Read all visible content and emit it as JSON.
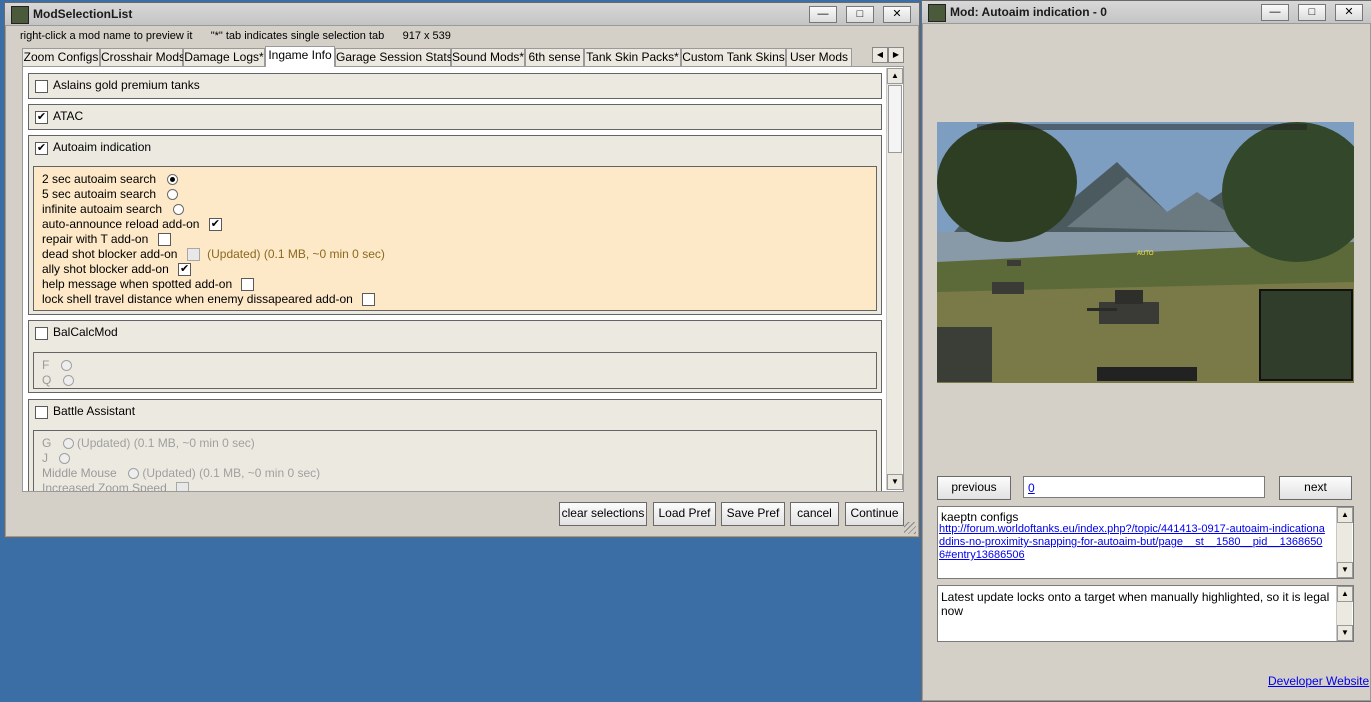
{
  "main_window": {
    "title": "ModSelectionList",
    "hint": "right-click a mod name to preview it      \"*\" tab indicates single selection tab      917 x 539",
    "tabs": [
      "Zoom Configs",
      "Crosshair Mods",
      "Damage Logs*",
      "Ingame Info",
      "Garage Session Stats*",
      "Sound Mods*",
      "6th sense",
      "Tank Skin Packs*",
      "Custom Tank Skins",
      "User Mods"
    ],
    "active_tab": "Ingame Info",
    "groups": {
      "aslains": {
        "label": "Aslains gold premium tanks",
        "checked": false
      },
      "atac": {
        "label": "ATAC",
        "checked": true
      },
      "autoaim": {
        "label": "Autoaim indication",
        "checked": true,
        "options": [
          {
            "label": "2 sec autoaim search",
            "kind": "radio",
            "on": true
          },
          {
            "label": "5 sec autoaim search",
            "kind": "radio",
            "on": false
          },
          {
            "label": "infinite autoaim search",
            "kind": "radio",
            "on": false
          },
          {
            "label": "auto-announce reload add-on",
            "kind": "check",
            "on": true
          },
          {
            "label": "repair with T add-on",
            "kind": "check",
            "on": false
          },
          {
            "label": "dead shot blocker add-on",
            "kind": "check",
            "on": false,
            "note": "(Updated) (0.1 MB, ~0 min 0 sec)"
          },
          {
            "label": "ally shot blocker add-on",
            "kind": "check",
            "on": true
          },
          {
            "label": "help message when spotted add-on",
            "kind": "check",
            "on": false
          },
          {
            "label": "lock shell travel distance when enemy dissapeared add-on",
            "kind": "check",
            "on": false
          }
        ]
      },
      "balcalc": {
        "label": "BalCalcMod",
        "checked": false,
        "options": [
          "F",
          "Q"
        ]
      },
      "battle": {
        "label": "Battle Assistant",
        "checked": false,
        "options": [
          {
            "label": "G",
            "note": "(Updated) (0.1 MB, ~0 min 0 sec)"
          },
          {
            "label": "J",
            "note": ""
          },
          {
            "label": "Middle Mouse",
            "note": "(Updated) (0.1 MB, ~0 min 0 sec)"
          },
          {
            "label": "Increased Zoom Speed",
            "note": ""
          }
        ]
      }
    },
    "buttons": {
      "clear": "clear selections",
      "load": "Load Pref",
      "save": "Save Pref",
      "cancel": "cancel",
      "continue": "Continue"
    }
  },
  "preview_window": {
    "title": "Mod: Autoaim indication - 0",
    "prev": "previous",
    "next": "next",
    "index": "0",
    "author": "kaeptn configs",
    "url": "http://forum.worldoftanks.eu/index.php?/topic/441413-0917-autoaim-indicationaddins-no-proximity-snapping-for-autoaim-but/page__st__1580__pid__13686506#entry13686506",
    "description": "Latest update locks onto a target when manually highlighted, so it is legal now",
    "dev_link": "Developer Website",
    "screenshot_label": "AUTO"
  },
  "colors": {
    "desktop": "#3a6ea5",
    "window": "#d4d0c8",
    "peach": "#fde8c8"
  }
}
